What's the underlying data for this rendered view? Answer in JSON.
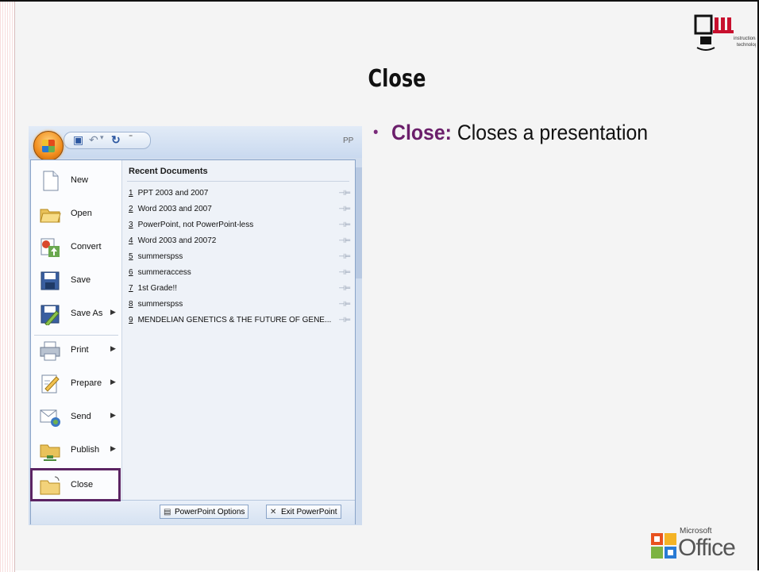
{
  "slide": {
    "title": "Close",
    "bullet_keyword": "Close:",
    "bullet_text": " Closes a presentation",
    "iu_logo_text": "instructional technology",
    "ms_logo_small": "Microsoft",
    "ms_logo_big": "Office",
    "accent_color": "#6b1f6b"
  },
  "app": {
    "title": "PP",
    "menu_items": [
      {
        "label": "New",
        "icon": "new-document-icon",
        "arrow": false
      },
      {
        "label": "Open",
        "icon": "open-folder-icon",
        "arrow": false
      },
      {
        "label": "Convert",
        "icon": "convert-icon",
        "arrow": false
      },
      {
        "label": "Save",
        "icon": "save-disk-icon",
        "arrow": false
      },
      {
        "label": "Save As",
        "icon": "save-as-icon",
        "arrow": true
      },
      {
        "label": "Print",
        "icon": "printer-icon",
        "arrow": true
      },
      {
        "label": "Prepare",
        "icon": "prepare-icon",
        "arrow": true
      },
      {
        "label": "Send",
        "icon": "send-icon",
        "arrow": true
      },
      {
        "label": "Publish",
        "icon": "publish-icon",
        "arrow": true
      },
      {
        "label": "Close",
        "icon": "close-folder-icon",
        "arrow": false
      }
    ],
    "recent_header": "Recent Documents",
    "recent": [
      {
        "num": "1",
        "name": "PPT 2003 and 2007"
      },
      {
        "num": "2",
        "name": "Word 2003 and 2007"
      },
      {
        "num": "3",
        "name": "PowerPoint, not PowerPoint-less"
      },
      {
        "num": "4",
        "name": "Word 2003 and 20072"
      },
      {
        "num": "5",
        "name": "summerspss"
      },
      {
        "num": "6",
        "name": "summeraccess"
      },
      {
        "num": "7",
        "name": "1st Grade!!"
      },
      {
        "num": "8",
        "name": "summerspss"
      },
      {
        "num": "9",
        "name": "MENDELIAN GENETICS & THE FUTURE OF GENE..."
      }
    ],
    "options_label": "PowerPoint Options",
    "exit_label": "Exit PowerPoint"
  }
}
